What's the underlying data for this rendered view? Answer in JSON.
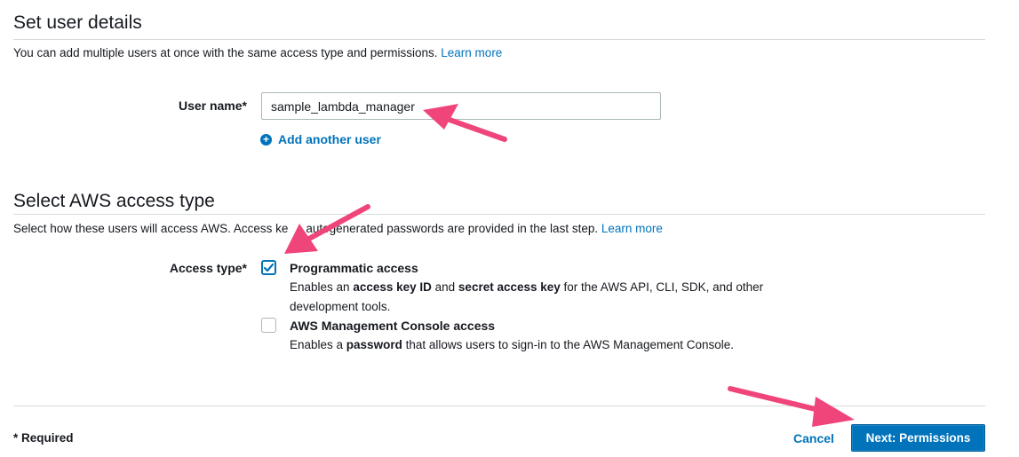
{
  "user_details": {
    "heading": "Set user details",
    "description": "You can add multiple users at once with the same access type and permissions.",
    "learn_more": "Learn more",
    "user_name_label": "User name*",
    "user_name_value": "sample_lambda_manager",
    "add_another_user": "Add another user"
  },
  "access_type": {
    "heading": "Select AWS access type",
    "description_before": "Select how these users will access AWS. Access ke",
    "description_after": "autogenerated passwords are provided in the last step.",
    "learn_more": "Learn more",
    "label": "Access type*",
    "options": [
      {
        "title": "Programmatic access",
        "checked": true,
        "desc": {
          "t1": "Enables an ",
          "b1": "access key ID",
          "t2": " and ",
          "b2": "secret access key",
          "t3": " for the AWS API, CLI, SDK, and other development tools."
        }
      },
      {
        "title": "AWS Management Console access",
        "checked": false,
        "desc": {
          "t1": "Enables a ",
          "b1": "password",
          "t2": " that allows users to sign-in to the AWS Management Console."
        }
      }
    ]
  },
  "footer": {
    "required_note": "* Required",
    "cancel_label": "Cancel",
    "next_label": "Next: Permissions"
  },
  "icons": {
    "add_user_icon": "plus-circle-icon",
    "checkbox_checked_icon": "checkmark-icon",
    "annotation_arrow_icon": "pointer-arrow-icon"
  },
  "colors": {
    "link": "#0073bb",
    "primary_button": "#0073bb",
    "annotation_arrow": "#f0457a",
    "divider": "#d5dbdb"
  }
}
